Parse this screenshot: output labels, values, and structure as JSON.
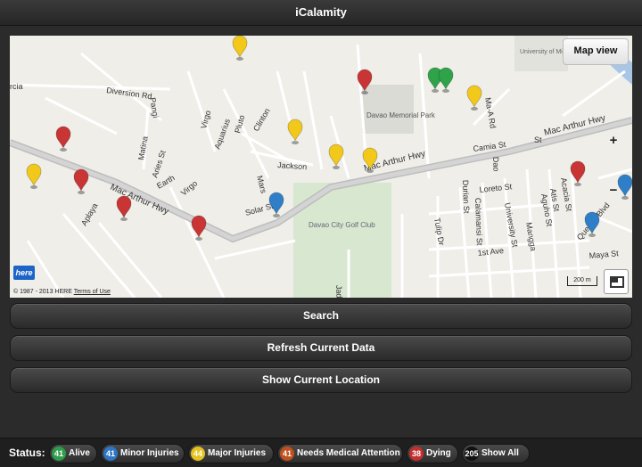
{
  "app": {
    "title": "iCalamity"
  },
  "map": {
    "map_view_label": "Map view",
    "zoom_in": "+",
    "zoom_out": "−",
    "copyright": "© 1987 - 2013 HERE",
    "terms": "Terms of Use",
    "scale": "200 m",
    "logo": "here",
    "street_labels": {
      "diversion": "Diversion Rd",
      "mac_arthur_1": "Mac Arthur Hwy",
      "mac_arthur_2": "Mac Arthur Hwy",
      "mac_arthur_3": "Mac Arthur Hwy",
      "golf": "Davao City Golf Club",
      "memorial": "Davao Memorial Park",
      "university": "University of Mindanao",
      "jackson": "Jackson",
      "solar": "Solar St",
      "earth": "Earth",
      "aries": "Aries St",
      "virgo": "Virgo",
      "virgo2": "Virgo",
      "aquarius": "Aquarius",
      "pluto": "Pluto",
      "clinton": "Clinton",
      "mars": "Mars",
      "matina": "Matina",
      "pangi": "Pangi",
      "aplaya": "Aplaya",
      "camia": "Camia St",
      "loreto": "Loreto St",
      "durian": "Durian St",
      "calamansi": "Calamansi St",
      "university_st": "University St",
      "dao": "Dao",
      "ma_a_rd": "Ma-A Rd",
      "tulip": "Tulip Dr",
      "first_ave": "1st Ave",
      "acacia": "Acacia St",
      "atis": "Atis St",
      "aguho": "Aguho St",
      "mangga": "Mangga",
      "quezon": "Quezon Blvd",
      "maya": "Maya St",
      "jade": "Jade",
      "rcia": "rcia",
      "bolton": "St"
    }
  },
  "actions": {
    "search": "Search",
    "refresh": "Refresh Current Data",
    "location": "Show Current Location"
  },
  "status": {
    "label": "Status:",
    "chips": [
      {
        "count": "41",
        "label": "Alive",
        "color": "#2e9e4a"
      },
      {
        "count": "41",
        "label": "Minor Injuries",
        "color": "#2f75c4"
      },
      {
        "count": "44",
        "label": "Major Injuries",
        "color": "#e6c21e"
      },
      {
        "count": "41",
        "label": "Needs Medical Attention",
        "color": "#c0501e"
      },
      {
        "count": "38",
        "label": "Dying",
        "color": "#c42f2f"
      },
      {
        "count": "205",
        "label": "Show All",
        "color": "#111111"
      }
    ]
  },
  "pin_colors": {
    "red": "#c93434",
    "yellow": "#f2c81b",
    "blue": "#2f7fc8",
    "green": "#2fa34a"
  }
}
